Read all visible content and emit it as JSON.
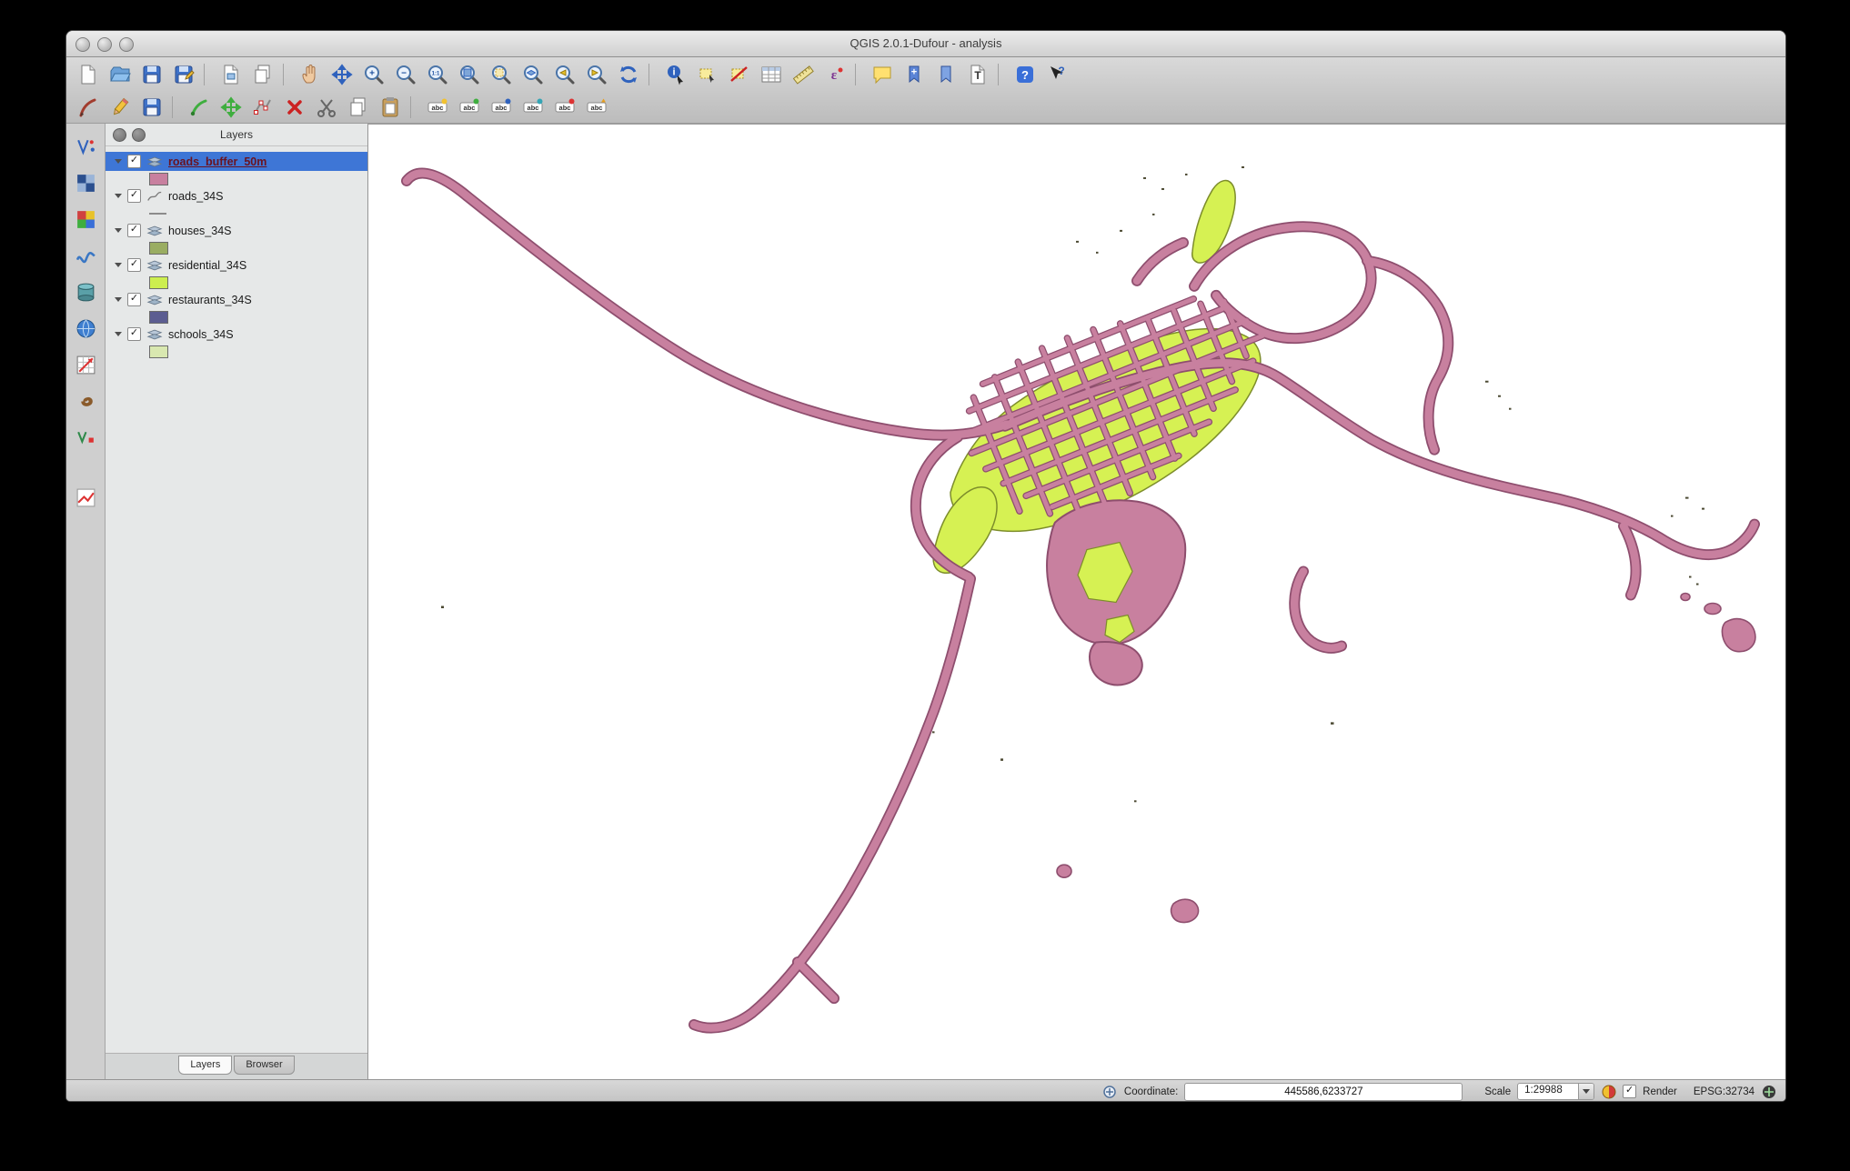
{
  "window": {
    "title": "QGIS 2.0.1-Dufour - analysis"
  },
  "glyphs": {
    "check": "✓",
    "plus": "+",
    "minus": "−",
    "one_to_one": "1:1",
    "info": "i",
    "question": "?",
    "text_tool": "T",
    "epsilon": "ε",
    "abc": "abc"
  },
  "toolbars": {
    "file": [
      "new-project",
      "open-project",
      "save-project",
      "save-project-as"
    ],
    "composer": [
      "new-print-composer",
      "composer-manager"
    ],
    "navigation": [
      "pan-map",
      "pan-to-selection",
      "zoom-in",
      "zoom-out",
      "zoom-actual-size",
      "zoom-full-extent",
      "zoom-to-selection",
      "zoom-to-layer",
      "zoom-last",
      "zoom-next",
      "refresh-map"
    ],
    "attributes": [
      "identify-features",
      "select-features",
      "deselect-features",
      "open-attribute-table",
      "measure-line",
      "show-statistics"
    ],
    "annotations": [
      "text-bubble-annotation",
      "new-bookmark",
      "show-bookmarks",
      "text-annotation"
    ],
    "help": [
      "help-contents",
      "whats-this"
    ],
    "digitizing": [
      "current-edits",
      "toggle-editing",
      "save-layer-edits",
      "add-feature",
      "move-feature",
      "node-tool",
      "delete-selected",
      "cut-features",
      "copy-features",
      "paste-features"
    ],
    "labeling": [
      "label-settings",
      "label-add",
      "label-move",
      "label-rotate",
      "label-properties",
      "label-pin"
    ],
    "plugin_sidebar": [
      "vector-tools",
      "raster-tools",
      "color-raster",
      "interpolation",
      "database",
      "web-services",
      "georeferencer",
      "heatmap",
      "topology-checker",
      "road-graph"
    ]
  },
  "layers_panel": {
    "title": "Layers",
    "items": [
      {
        "name": "roads_buffer_50m",
        "checked": true,
        "selected": true,
        "swatch": "#c8809f",
        "symbol": "fill"
      },
      {
        "name": "roads_34S",
        "checked": true,
        "selected": false,
        "swatch": "#8c8c8c",
        "symbol": "line"
      },
      {
        "name": "houses_34S",
        "checked": true,
        "selected": false,
        "swatch": "#9aad62",
        "symbol": "fill"
      },
      {
        "name": "residential_34S",
        "checked": true,
        "selected": false,
        "swatch": "#cdee4f",
        "symbol": "fill"
      },
      {
        "name": "restaurants_34S",
        "checked": true,
        "selected": false,
        "swatch": "#5c5d91",
        "symbol": "fill"
      },
      {
        "name": "schools_34S",
        "checked": true,
        "selected": false,
        "swatch": "#d9e8b0",
        "symbol": "fill"
      }
    ],
    "tabs": [
      {
        "label": "Layers",
        "active": true
      },
      {
        "label": "Browser",
        "active": false
      }
    ]
  },
  "statusbar": {
    "coordinate_label": "Coordinate:",
    "coordinate_value": "445586,6233727",
    "scale_label": "Scale",
    "scale_value": "1:29988",
    "render_label": "Render",
    "crs_label": "EPSG:32734"
  },
  "map": {
    "colors": {
      "road_fill": "#c8809f",
      "road_casing": "#8e4e6e",
      "residential_fill": "#d6f153",
      "residential_stroke": "#7d8d2b",
      "background": "#ffffff",
      "speckle": "#4c4a33"
    }
  }
}
